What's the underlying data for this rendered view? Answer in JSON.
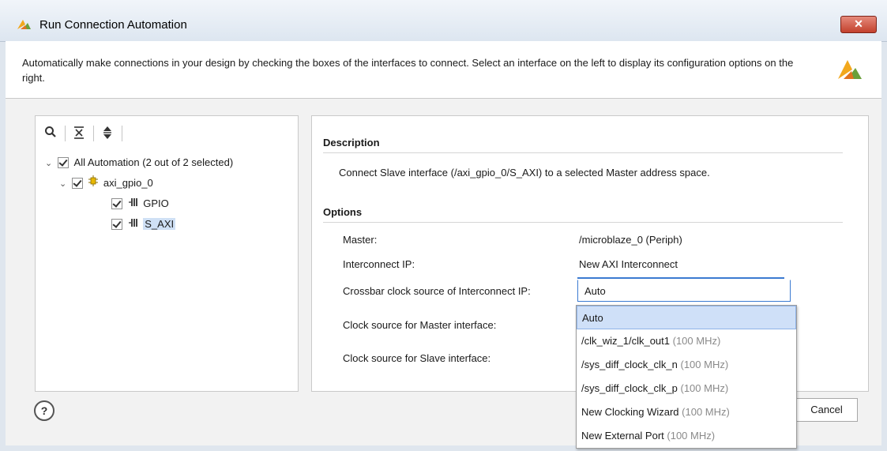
{
  "window": {
    "title": "Run Connection Automation",
    "close_glyph": "✕"
  },
  "header": {
    "description": "Automatically make connections in your design by checking the boxes of the interfaces to connect. Select an interface on the left to display its configuration options on the right."
  },
  "toolbar": {
    "search_icon": "search-icon",
    "collapse_icon": "collapse-all-icon",
    "expand_icon": "expand-all-icon"
  },
  "tree": {
    "root": "All Automation (2 out of 2 selected)",
    "block": "axi_gpio_0",
    "interfaces": [
      {
        "label": "GPIO"
      },
      {
        "label": "S_AXI"
      }
    ]
  },
  "description_section": {
    "title": "Description",
    "text": "Connect Slave interface (/axi_gpio_0/S_AXI) to a selected Master address space."
  },
  "options_section": {
    "title": "Options",
    "master_label": "Master:",
    "master_value": "/microblaze_0 (Periph)",
    "interconnect_label": "Interconnect IP:",
    "interconnect_value": "New AXI Interconnect",
    "crossbar_label": "Crossbar clock source of Interconnect IP:",
    "crossbar_value": "Auto",
    "master_clock_label": "Clock source for Master interface:",
    "slave_clock_label": "Clock source for Slave interface:"
  },
  "dropdown_options": [
    {
      "name": "Auto",
      "freq": "",
      "selected": true
    },
    {
      "name": "/clk_wiz_1/clk_out1",
      "freq": "(100 MHz)"
    },
    {
      "name": "/sys_diff_clock_clk_n",
      "freq": "(100 MHz)"
    },
    {
      "name": "/sys_diff_clock_clk_p",
      "freq": "(100 MHz)"
    },
    {
      "name": "New Clocking Wizard",
      "freq": "(100 MHz)"
    },
    {
      "name": "New External Port",
      "freq": "(100 MHz)"
    }
  ],
  "footer": {
    "help_glyph": "?",
    "cancel_label": "Cancel"
  },
  "colors": {
    "accent": "#3b7ad1",
    "selection": "#cfe0f8",
    "close": "#c3412d"
  }
}
